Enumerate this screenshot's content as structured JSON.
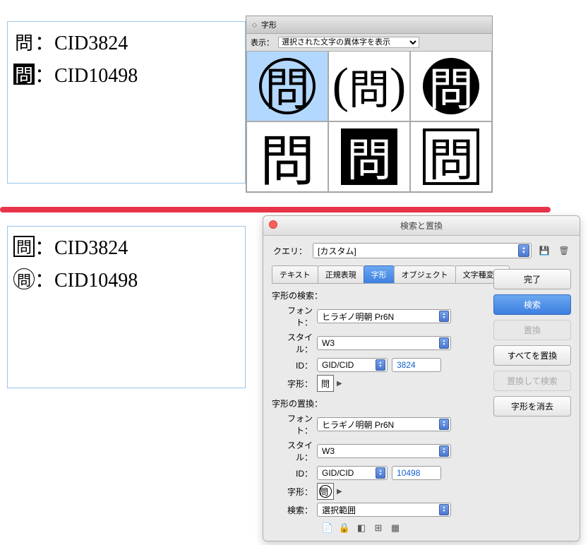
{
  "doc": {
    "line1_glyph": "問",
    "line1_text": "：CID3824",
    "line2_glyph": "問",
    "line2_text": "：CID10498",
    "line3_glyph": "問",
    "line3_text": "：CID3824",
    "line4_glyph": "問",
    "line4_text": "：CID10498"
  },
  "glyph_panel": {
    "title": "字形",
    "display_label": "表示：",
    "display_option": "選択された文字の異体字を表示",
    "glyph": "問"
  },
  "dialog": {
    "title": "検索と置換",
    "query_label": "クエリ：",
    "query_value": "[カスタム]",
    "tabs": {
      "text": "テキスト",
      "regex": "正規表現",
      "glyph": "字形",
      "object": "オブジェクト",
      "chartype": "文字種変換"
    },
    "find_section": "字形の検索：",
    "replace_section": "字形の置換：",
    "font_label": "フォント：",
    "font_value": "ヒラギノ明朝 Pr6N",
    "style_label": "スタイル：",
    "style_value": "W3",
    "id_label": "ID：",
    "id_type": "GID/CID",
    "find_id": "3824",
    "replace_id": "10498",
    "glyph_label": "字形：",
    "find_glyph": "問",
    "replace_glyph": "問",
    "scope_label": "検索：",
    "scope_value": "選択範囲",
    "buttons": {
      "done": "完了",
      "find": "検索",
      "replace": "置換",
      "replace_all": "すべてを置換",
      "replace_find": "置換して検索",
      "clear_glyph": "字形を消去"
    }
  }
}
